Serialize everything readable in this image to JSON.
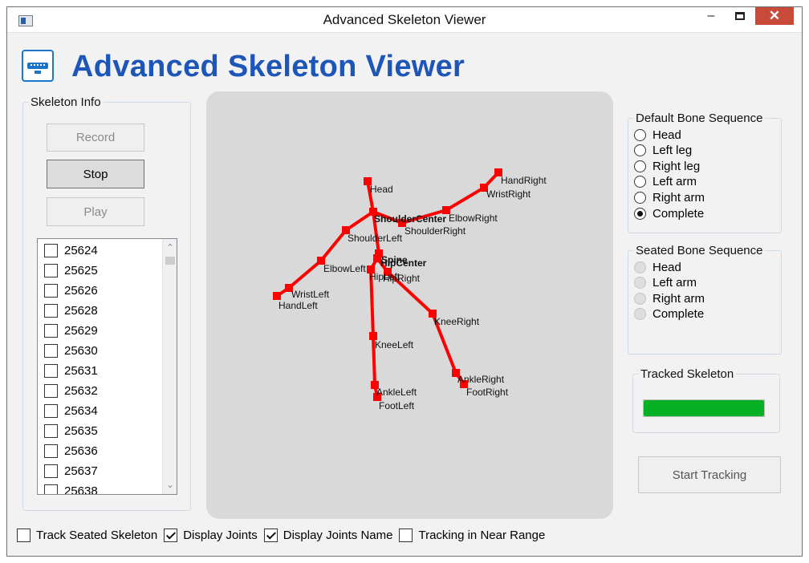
{
  "window": {
    "title": "Advanced Skeleton Viewer"
  },
  "header": {
    "title": "Advanced Skeleton Viewer"
  },
  "skeleton_info": {
    "legend": "Skeleton Info",
    "record_label": "Record",
    "stop_label": "Stop",
    "play_label": "Play",
    "frames": [
      {
        "id": "25624",
        "checked": false
      },
      {
        "id": "25625",
        "checked": false
      },
      {
        "id": "25626",
        "checked": false
      },
      {
        "id": "25628",
        "checked": false
      },
      {
        "id": "25629",
        "checked": false
      },
      {
        "id": "25630",
        "checked": false
      },
      {
        "id": "25631",
        "checked": false
      },
      {
        "id": "25632",
        "checked": false
      },
      {
        "id": "25634",
        "checked": false
      },
      {
        "id": "25635",
        "checked": false
      },
      {
        "id": "25636",
        "checked": false
      },
      {
        "id": "25637",
        "checked": false
      },
      {
        "id": "25638",
        "checked": false
      }
    ]
  },
  "skeleton": {
    "bone_color": "#ff0000",
    "joint_color": "#ff0000",
    "joints": [
      {
        "name": "Head",
        "label": "Head"
      },
      {
        "name": "ShoulderCenter",
        "label": "ShoulderCenter"
      },
      {
        "name": "ShoulderLeft",
        "label": "ShoulderLeft"
      },
      {
        "name": "ShoulderRight",
        "label": "ShoulderRight"
      },
      {
        "name": "ElbowLeft",
        "label": "ElbowLeft"
      },
      {
        "name": "ElbowRight",
        "label": "ElbowRight"
      },
      {
        "name": "WristLeft",
        "label": "WristLeft"
      },
      {
        "name": "WristRight",
        "label": "WristRight"
      },
      {
        "name": "HandLeft",
        "label": "HandLeft"
      },
      {
        "name": "HandRight",
        "label": "HandRight"
      },
      {
        "name": "Spine",
        "label": "Spine"
      },
      {
        "name": "HipCenter",
        "label": "HipCenter"
      },
      {
        "name": "HipLeft",
        "label": "HipLeft"
      },
      {
        "name": "HipRight",
        "label": "HipRight"
      },
      {
        "name": "KneeLeft",
        "label": "KneeLeft"
      },
      {
        "name": "KneeRight",
        "label": "KneeRight"
      },
      {
        "name": "AnkleLeft",
        "label": "AnkleLeft"
      },
      {
        "name": "AnkleRight",
        "label": "AnkleRight"
      },
      {
        "name": "FootLeft",
        "label": "FootLeft"
      },
      {
        "name": "FootRight",
        "label": "FootRight"
      }
    ]
  },
  "default_sequence": {
    "legend": "Default Bone Sequence",
    "options": [
      {
        "label": "Head",
        "checked": false
      },
      {
        "label": "Left leg",
        "checked": false
      },
      {
        "label": "Right leg",
        "checked": false
      },
      {
        "label": "Left arm",
        "checked": false
      },
      {
        "label": "Right arm",
        "checked": false
      },
      {
        "label": "Complete",
        "checked": true
      }
    ]
  },
  "seated_sequence": {
    "legend": "Seated Bone Sequence",
    "options": [
      {
        "label": "Head",
        "checked": false
      },
      {
        "label": "Left arm",
        "checked": false
      },
      {
        "label": "Right arm",
        "checked": false
      },
      {
        "label": "Complete",
        "checked": false
      }
    ]
  },
  "tracked": {
    "legend": "Tracked Skeleton",
    "level": 1.0,
    "color": "#06b025"
  },
  "start_tracking_label": "Start Tracking",
  "options_bar": [
    {
      "label": "Track Seated Skeleton",
      "checked": false
    },
    {
      "label": "Display Joints",
      "checked": true
    },
    {
      "label": "Display Joints Name",
      "checked": true
    },
    {
      "label": "Tracking in Near Range",
      "checked": false
    }
  ]
}
